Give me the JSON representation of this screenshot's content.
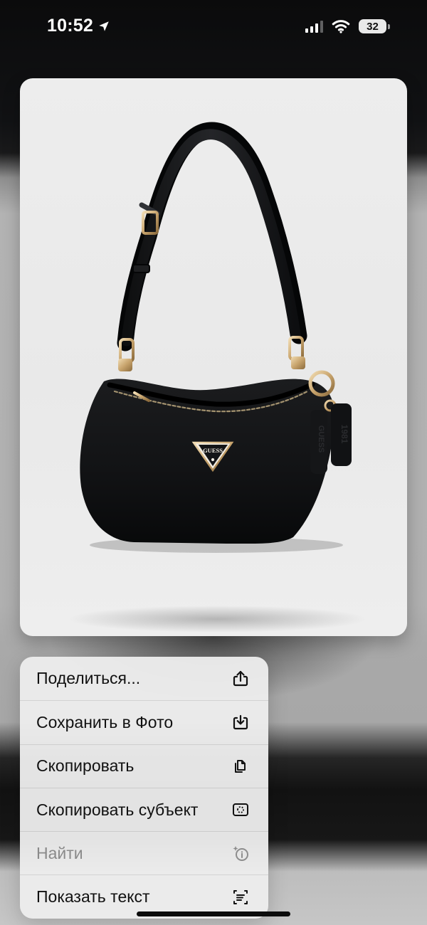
{
  "status_bar": {
    "time": "10:52",
    "battery": "32",
    "icons": [
      "location-arrow-icon",
      "signal-icon",
      "wifi-icon",
      "battery-icon"
    ]
  },
  "preview": {
    "brand_text": "GUESS",
    "tag_left_text": "GUESS",
    "tag_right_text": "1981"
  },
  "menu": {
    "items": [
      {
        "label": "Поделиться...",
        "icon": "share-icon",
        "enabled": true
      },
      {
        "label": "Сохранить в Фото",
        "icon": "save-to-photos-icon",
        "enabled": true
      },
      {
        "label": "Скопировать",
        "icon": "copy-icon",
        "enabled": true
      },
      {
        "label": "Скопировать субъект",
        "icon": "copy-subject-icon",
        "enabled": true
      },
      {
        "label": "Найти",
        "icon": "visual-lookup-icon",
        "enabled": false
      },
      {
        "label": "Показать текст",
        "icon": "show-text-icon",
        "enabled": true
      }
    ]
  },
  "colors": {
    "menu_background": "#ECECEC",
    "preview_background": "#EDEDED",
    "bag": "#111214",
    "hardware": "#C9A66E"
  }
}
